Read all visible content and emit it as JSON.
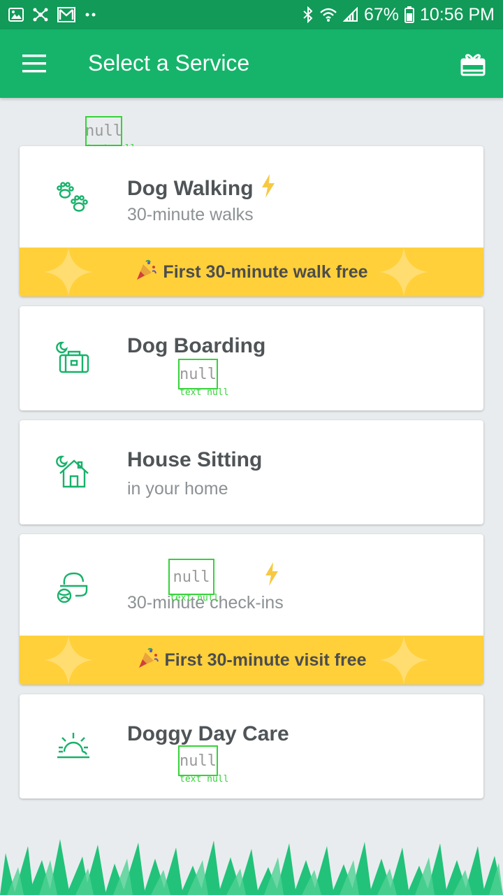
{
  "status_bar": {
    "battery": "67%",
    "time": "10:56 PM",
    "icons": [
      "image-icon",
      "network-icon",
      "gmail-icon",
      "dots-icon",
      "bluetooth-icon",
      "wifi-icon",
      "signal-icon",
      "battery-icon"
    ]
  },
  "app_bar": {
    "title": "Select a Service",
    "menu_icon": "hamburger-menu-icon",
    "gift_icon": "gift-icon"
  },
  "null_labels": {
    "value": "null",
    "caption": "text null"
  },
  "services": [
    {
      "title": "Dog Walking",
      "subtitle": "30-minute walks",
      "icon": "paws-icon",
      "badge_icon": "lightning-icon",
      "promo": "First 30-minute walk free"
    },
    {
      "title": "Dog Boarding",
      "subtitle": "",
      "icon": "suitcase-icon"
    },
    {
      "title": "House Sitting",
      "subtitle": "in your home",
      "icon": "house-icon"
    },
    {
      "title": "",
      "subtitle": "30-minute check-ins",
      "icon": "food-bowl-icon",
      "badge_icon": "lightning-icon",
      "promo": "First 30-minute visit free"
    },
    {
      "title": "Doggy Day Care",
      "subtitle": "",
      "icon": "sun-icon"
    }
  ],
  "colors": {
    "status_bar": "#119a58",
    "app_bar": "#15b46a",
    "icon_green": "#17b26a",
    "promo_yellow": "#ffd03a",
    "lightning": "#f6c944",
    "grass": "#22c27a"
  }
}
